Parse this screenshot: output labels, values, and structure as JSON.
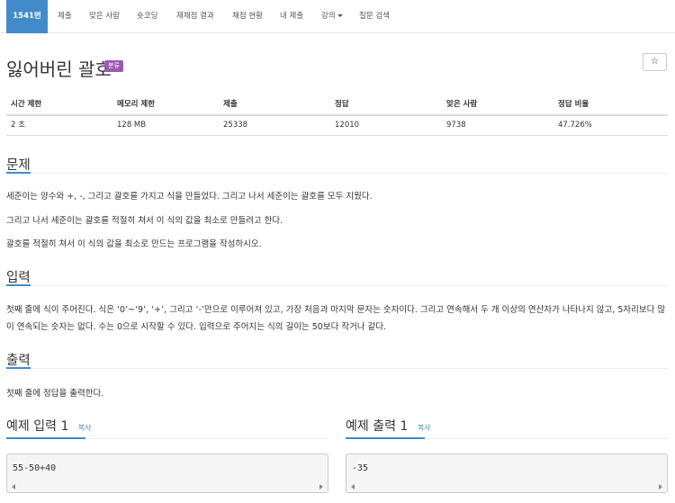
{
  "nav": {
    "items": [
      {
        "label": "1541번",
        "active": true
      },
      {
        "label": "제출"
      },
      {
        "label": "맞은 사람"
      },
      {
        "label": "숏코딩"
      },
      {
        "label": "재채점 결과"
      },
      {
        "label": "채점 현황"
      },
      {
        "label": "내 제출"
      },
      {
        "label": "강의",
        "dropdown": true
      },
      {
        "label": "질문 검색"
      }
    ]
  },
  "problem": {
    "title": "잃어버린 괄호",
    "badge": "분류",
    "star_icon": "☆"
  },
  "info_table": {
    "headers": [
      "시간 제한",
      "메모리 제한",
      "제출",
      "정답",
      "맞은 사람",
      "정답 비율"
    ],
    "values": [
      "2 초",
      "128 MB",
      "25338",
      "12010",
      "9738",
      "47.726%"
    ]
  },
  "sections": {
    "problem": {
      "heading": "문제",
      "paragraphs": [
        "세준이는 양수와 +, -, 그리고 괄호를 가지고 식을 만들었다. 그리고 나서 세준이는 괄호를 모두 지웠다.",
        "그리고 나서 세준이는 괄호를 적절히 쳐서 이 식의 값을 최소로 만들려고 한다.",
        "괄호를 적절히 쳐서 이 식의 값을 최소로 만드는 프로그램을 작성하시오."
      ]
    },
    "input": {
      "heading": "입력",
      "text": "첫째 줄에 식이 주어진다. 식은 ‘0’~‘9’, ‘+’, 그리고 ‘-’만으로 이루어져 있고, 가장 처음과 마지막 문자는 숫자이다. 그리고 연속해서 두 개 이상의 연산자가 나타나지 않고, 5자리보다 많이 연속되는 숫자는 없다. 수는 0으로 시작할 수 있다. 입력으로 주어지는 식의 길이는 50보다 작거나 같다."
    },
    "output": {
      "heading": "출력",
      "text": "첫째 줄에 정답을 출력한다."
    }
  },
  "examples": {
    "input": {
      "heading": "예제 입력",
      "number": "1",
      "copy_label": "복사",
      "content": "55-50+40"
    },
    "output": {
      "heading": "예제 출력",
      "number": "1",
      "copy_label": "복사",
      "content": "-35"
    }
  }
}
